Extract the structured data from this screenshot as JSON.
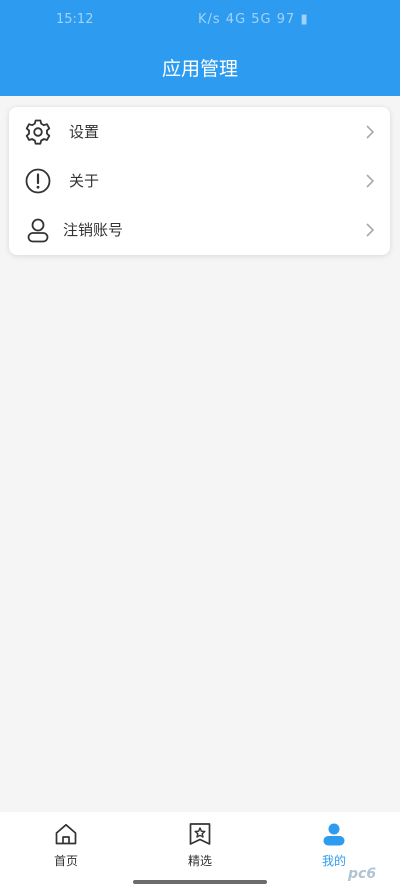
{
  "status_bar": {
    "time": "15:12",
    "indicators": "K/s 4G 5G 97 ▮"
  },
  "header": {
    "title": "应用管理"
  },
  "menu": {
    "items": [
      {
        "label": "设置",
        "icon": "gear-icon"
      },
      {
        "label": "关于",
        "icon": "info-icon"
      },
      {
        "label": "注销账号",
        "icon": "user-icon"
      }
    ]
  },
  "bottom_nav": {
    "items": [
      {
        "label": "首页",
        "icon": "home-icon",
        "active": false
      },
      {
        "label": "精选",
        "icon": "bookmark-star-icon",
        "active": false
      },
      {
        "label": "我的",
        "icon": "profile-icon",
        "active": true
      }
    ]
  },
  "watermark": "pc6",
  "colors": {
    "primary": "#2d9cf0",
    "background": "#f5f5f5",
    "text": "#333333"
  }
}
